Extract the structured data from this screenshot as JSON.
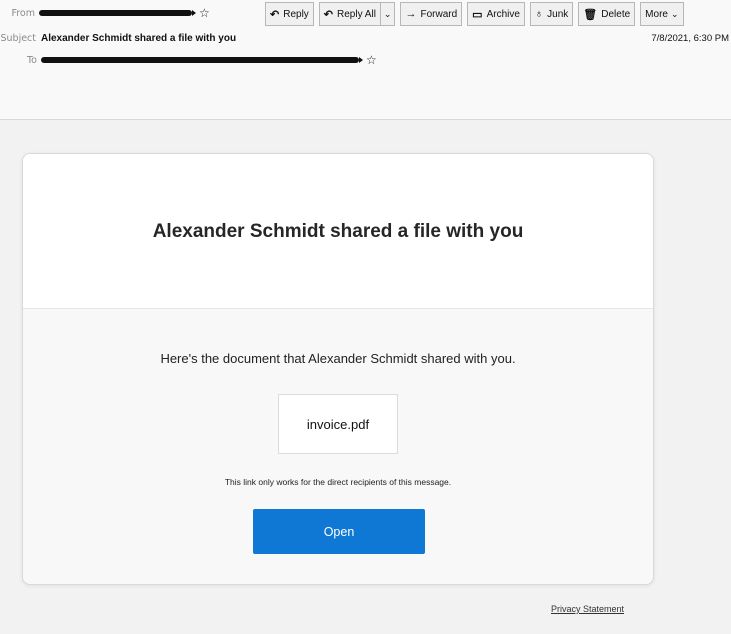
{
  "header": {
    "from_label": "From",
    "from_value_redacted": true,
    "subject_label": "Subject",
    "subject": "Alexander Schmidt shared a file with you",
    "to_label": "To",
    "to_value_redacted": true,
    "date": "7/8/2021, 6:30 PM",
    "star_icon": "☆"
  },
  "toolbar": {
    "reply": {
      "icon": "↶",
      "label": "Reply"
    },
    "reply_all": {
      "icon": "↶",
      "label": "Reply All",
      "chevron": "⌄"
    },
    "forward": {
      "icon": "→",
      "label": "Forward"
    },
    "archive": {
      "icon": "▭",
      "label": "Archive"
    },
    "junk": {
      "icon": "♁",
      "label": "Junk"
    },
    "delete": {
      "icon": "🗑",
      "label": "Delete"
    },
    "more": {
      "label": "More",
      "chevron": "⌄"
    }
  },
  "card": {
    "title": "Alexander Schmidt shared a file with you",
    "message": "Here's the document that Alexander Schmidt shared with you.",
    "file_name": "invoice.pdf",
    "link_note": "This link only works for the direct recipients of this message.",
    "open_label": "Open",
    "accent_color": "#0f78d4"
  },
  "footer": {
    "privacy_label": "Privacy Statement"
  }
}
